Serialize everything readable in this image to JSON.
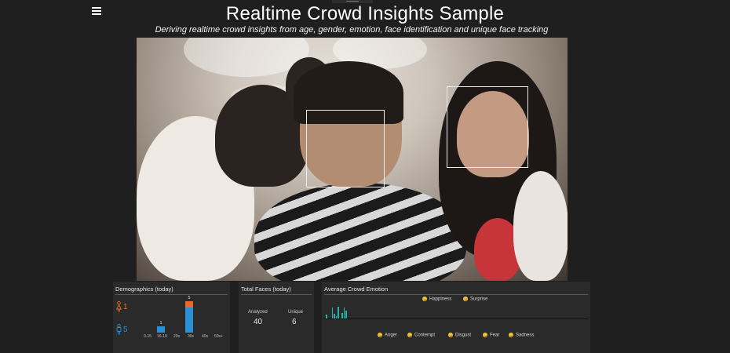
{
  "app": {
    "title": "Realtime Crowd Insights Sample",
    "subtitle": "Deriving realtime crowd insights from age, gender, emotion, face identification and unique face tracking"
  },
  "demographics": {
    "header": "Demographics (today)",
    "female_count": "1",
    "male_count": "5",
    "colors": {
      "female": "#e8692b",
      "male": "#2b8fd6"
    },
    "age_groups": [
      "0-15",
      "16-19",
      "20s",
      "30s",
      "40s",
      "50s+"
    ],
    "bars": [
      {
        "group": "0-15",
        "female": 0,
        "male": 0,
        "label": ""
      },
      {
        "group": "16-19",
        "female": 0,
        "male": 1,
        "label": "1"
      },
      {
        "group": "20s",
        "female": 0,
        "male": 0,
        "label": ""
      },
      {
        "group": "30s",
        "female": 1,
        "male": 4,
        "label": "5"
      },
      {
        "group": "40s",
        "female": 0,
        "male": 0,
        "label": ""
      },
      {
        "group": "50s+",
        "female": 0,
        "male": 0,
        "label": ""
      }
    ]
  },
  "total_faces": {
    "header": "Total Faces (today)",
    "analyzed_label": "Analyzed",
    "analyzed_value": "40",
    "unique_label": "Unique",
    "unique_value": "6"
  },
  "emotion": {
    "header": "Average Crowd Emotion",
    "bar_color": "#1fb8a8",
    "top_labels": [
      "Happiness",
      "Surprise"
    ],
    "bottom_labels": [
      "Anger",
      "Contempt",
      "Disgust",
      "Fear",
      "Sadness"
    ],
    "levels": [
      0.25,
      0,
      0,
      0.7,
      0.3,
      0.15,
      0.75,
      0,
      0.35,
      0.7,
      0.5
    ]
  },
  "icons": {
    "menu": "hamburger-icon",
    "female": "female-person-icon",
    "male": "male-person-icon",
    "emotion": "smiley-icon"
  }
}
